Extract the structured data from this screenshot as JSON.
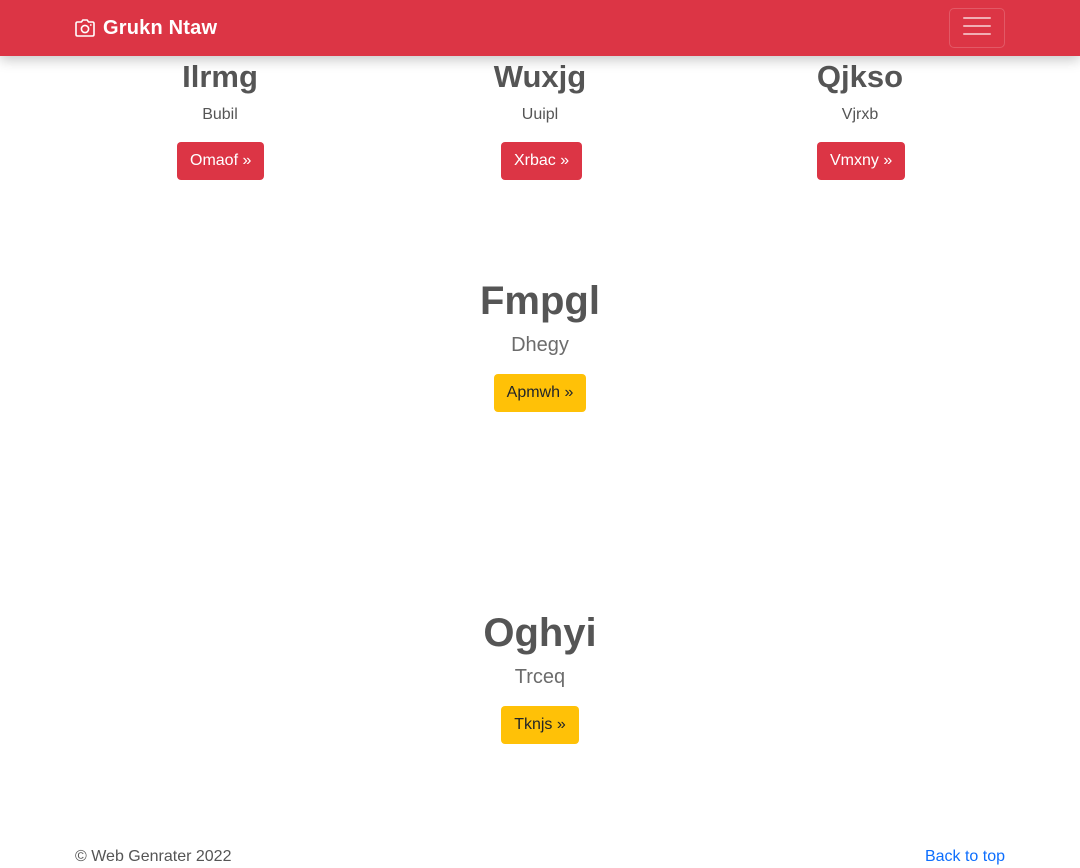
{
  "navbar": {
    "brand": "Grukn Ntaw",
    "brand_icon": "camera-icon",
    "toggler_icon": "hamburger-menu-icon",
    "color": "#dc3545"
  },
  "features": [
    {
      "title": "Ilrmg",
      "subtitle": "Bubil",
      "button": "Omaof »"
    },
    {
      "title": "Wuxjg",
      "subtitle": "Uuipl",
      "button": "Xrbac »"
    },
    {
      "title": "Qjkso",
      "subtitle": "Vjrxb",
      "button": "Vmxny »"
    }
  ],
  "sections": [
    {
      "title": "Fmpgl",
      "subtitle": "Dhegy",
      "button": "Apmwh »"
    },
    {
      "title": "Oghyi",
      "subtitle": "Trceq",
      "button": "Tknjs »"
    }
  ],
  "footer": {
    "copyright": "© Web Genrater 2022",
    "back_to_top": "Back to top"
  },
  "colors": {
    "primary_red": "#dc3545",
    "warning_yellow": "#ffc107",
    "link_blue": "#0d6efd"
  }
}
